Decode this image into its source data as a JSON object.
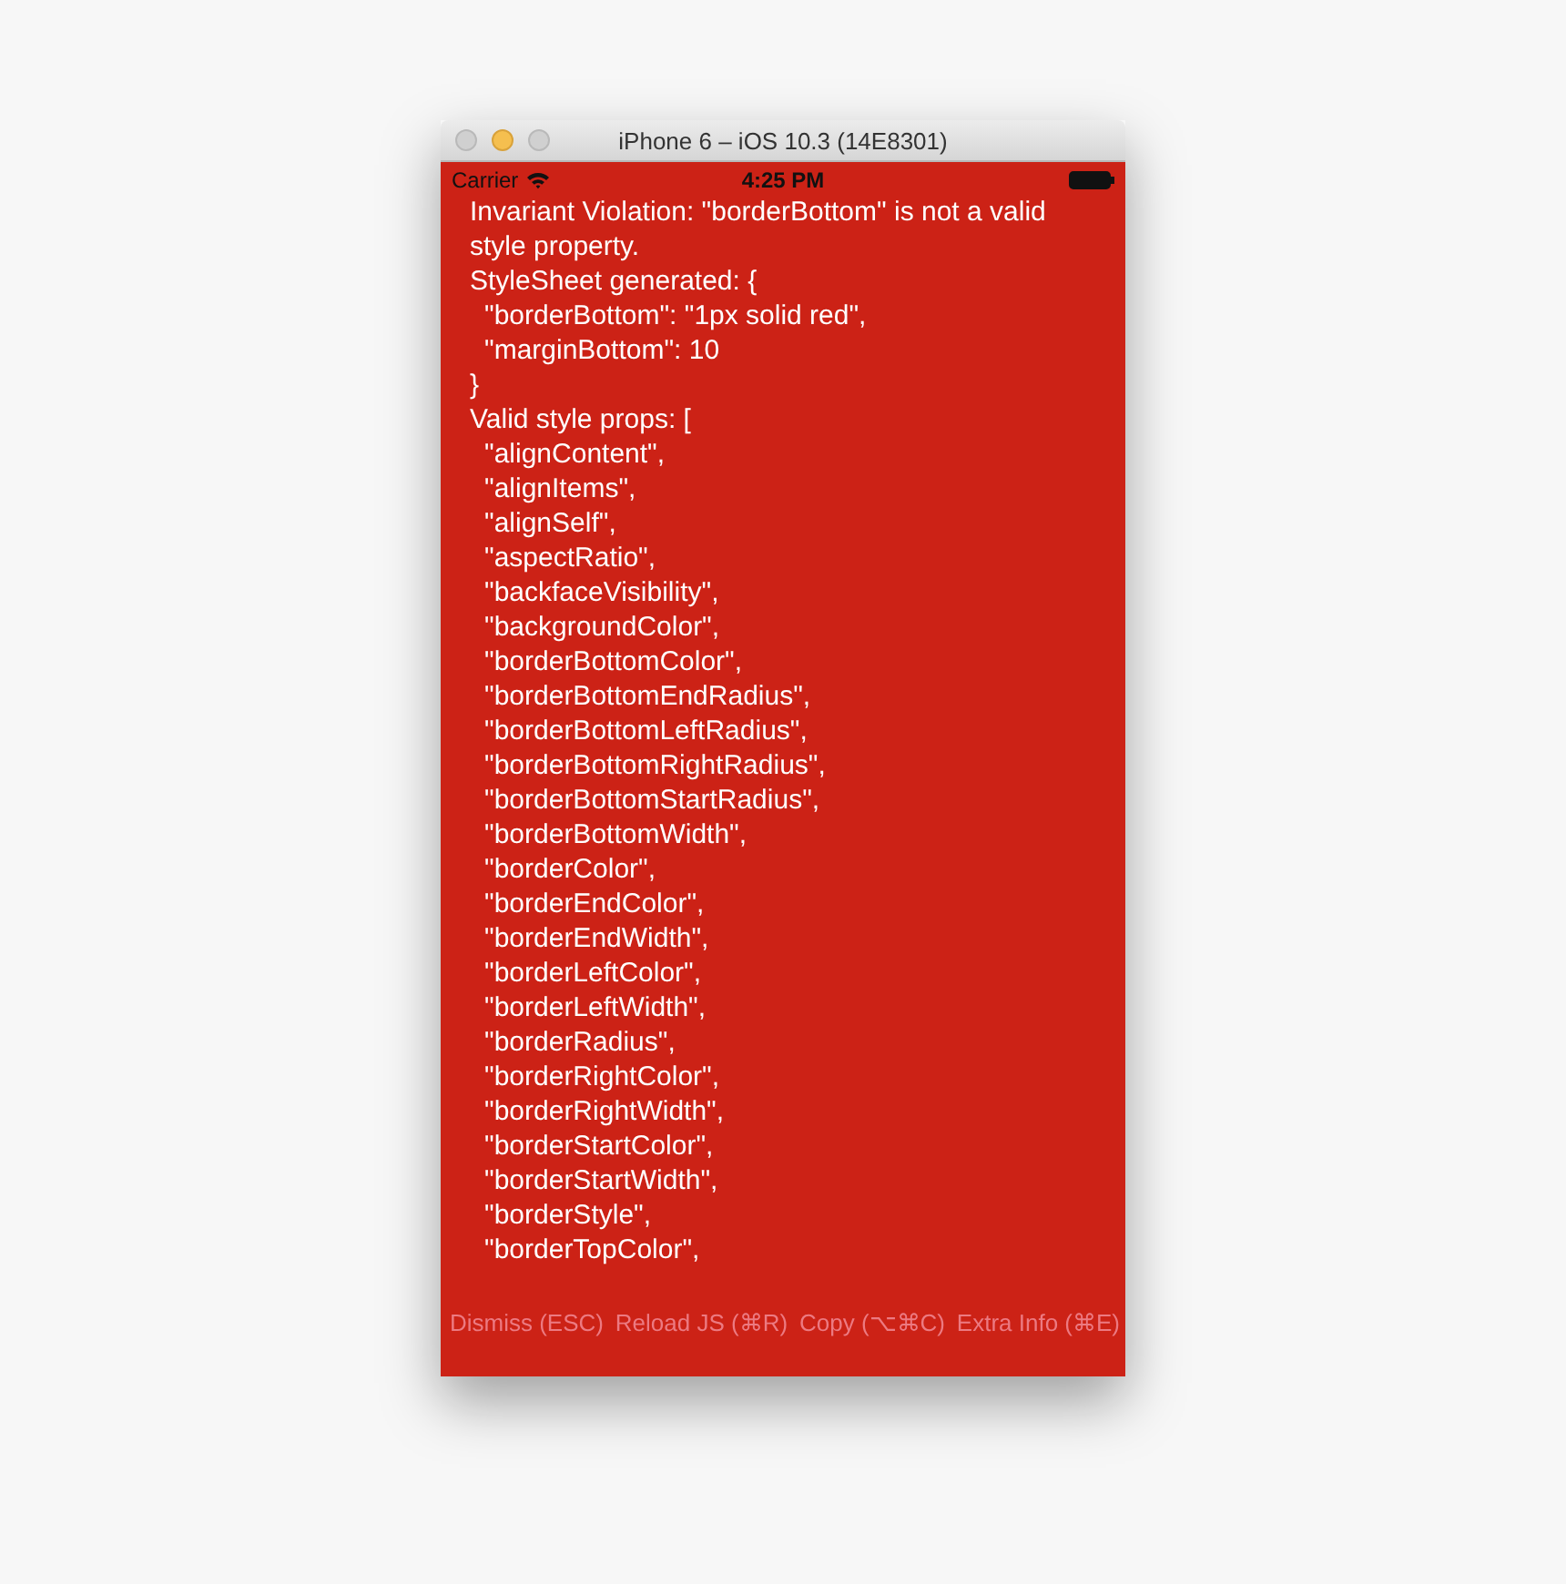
{
  "window": {
    "title": "iPhone 6 – iOS 10.3 (14E8301)"
  },
  "status_bar": {
    "carrier": "Carrier",
    "time": "4:25 PM"
  },
  "error": {
    "message": "Invariant Violation: \"borderBottom\" is not a valid style property.",
    "lines": [
      {
        "text": "StyleSheet generated: {",
        "kind": "top"
      },
      {
        "text": "\"borderBottom\": \"1px solid red\",",
        "kind": "nested"
      },
      {
        "text": "\"marginBottom\": 10",
        "kind": "nested"
      },
      {
        "text": "}",
        "kind": "top"
      },
      {
        "text": "Valid style props: [",
        "kind": "top"
      },
      {
        "text": "\"alignContent\",",
        "kind": "nested"
      },
      {
        "text": "\"alignItems\",",
        "kind": "nested"
      },
      {
        "text": "\"alignSelf\",",
        "kind": "nested"
      },
      {
        "text": "\"aspectRatio\",",
        "kind": "nested"
      },
      {
        "text": "\"backfaceVisibility\",",
        "kind": "nested"
      },
      {
        "text": "\"backgroundColor\",",
        "kind": "nested"
      },
      {
        "text": "\"borderBottomColor\",",
        "kind": "nested"
      },
      {
        "text": "\"borderBottomEndRadius\",",
        "kind": "nested"
      },
      {
        "text": "\"borderBottomLeftRadius\",",
        "kind": "nested"
      },
      {
        "text": "\"borderBottomRightRadius\",",
        "kind": "nested"
      },
      {
        "text": "\"borderBottomStartRadius\",",
        "kind": "nested"
      },
      {
        "text": "\"borderBottomWidth\",",
        "kind": "nested"
      },
      {
        "text": "\"borderColor\",",
        "kind": "nested"
      },
      {
        "text": "\"borderEndColor\",",
        "kind": "nested"
      },
      {
        "text": "\"borderEndWidth\",",
        "kind": "nested"
      },
      {
        "text": "\"borderLeftColor\",",
        "kind": "nested"
      },
      {
        "text": "\"borderLeftWidth\",",
        "kind": "nested"
      },
      {
        "text": "\"borderRadius\",",
        "kind": "nested"
      },
      {
        "text": "\"borderRightColor\",",
        "kind": "nested"
      },
      {
        "text": "\"borderRightWidth\",",
        "kind": "nested"
      },
      {
        "text": "\"borderStartColor\",",
        "kind": "nested"
      },
      {
        "text": "\"borderStartWidth\",",
        "kind": "nested"
      },
      {
        "text": "\"borderStyle\",",
        "kind": "nested"
      },
      {
        "text": "\"borderTopColor\",",
        "kind": "nested"
      }
    ]
  },
  "buttons": [
    "Dismiss (ESC)",
    "Reload JS (⌘R)",
    "Copy (⌥⌘C)",
    "Extra Info (⌘E)"
  ]
}
